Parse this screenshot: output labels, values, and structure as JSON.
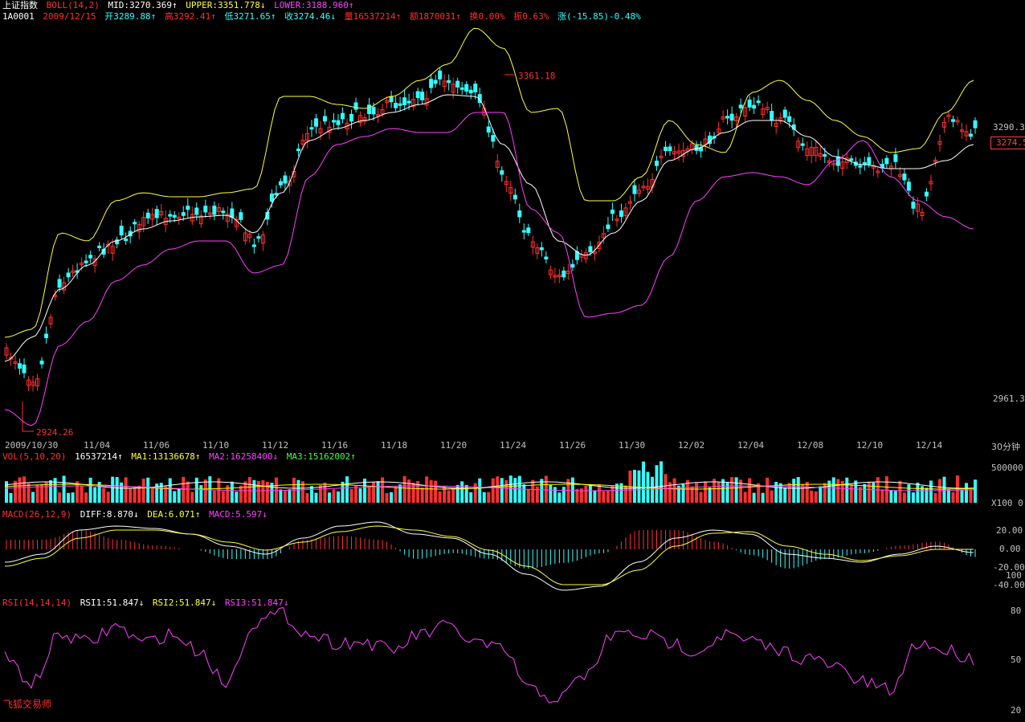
{
  "header1": {
    "index_name": "上证指数",
    "boll_label": "BOLL(14,2)",
    "mid": "MID:3270.369↑",
    "upper": "UPPER:3351.778↓",
    "lower": "LOWER:3188.960↑"
  },
  "header2": {
    "code": "1A0001",
    "date": "2009/12/15",
    "open": "开3289.88↑",
    "high": "高3292.41↑",
    "low": "低3271.65↑",
    "close": "收3274.46↓",
    "volume": "量16537214↑",
    "amount": "额1870031↑",
    "turnover": "换0.00%",
    "amplitude": "振0.63%",
    "change": "涨(-15.85)-0.48%"
  },
  "price_axis": {
    "top": "3290.3",
    "current": "3274.5",
    "bottom": "2961.3"
  },
  "annotations": {
    "high_mark": "3361.18",
    "low_mark": "2924.26"
  },
  "dates": [
    "2009/10/30",
    "11/04",
    "11/06",
    "11/10",
    "11/12",
    "11/16",
    "11/18",
    "11/20",
    "11/24",
    "11/26",
    "11/30",
    "12/02",
    "12/04",
    "12/08",
    "12/10",
    "12/14"
  ],
  "period": "30分钟",
  "vol_header": {
    "label": "VOL(5,10,20)",
    "vol": "16537214↑",
    "ma1": "MA1:13136678↑",
    "ma2": "MA2:16258400↓",
    "ma3": "MA3:15162002↑"
  },
  "vol_axis": {
    "top": "500000",
    "bottom": "X100 0"
  },
  "macd_header": {
    "label": "MACD(26,12,9)",
    "diff": "DIFF:8.870↓",
    "dea": "DEA:6.071↑",
    "macd": "MACD:5.597↓"
  },
  "macd_axis": [
    "20.00",
    "0.00",
    "-20.00",
    "100",
    "-40.00"
  ],
  "rsi_header": {
    "label": "RSI(14,14,14)",
    "rsi1": "RSI1:51.847↓",
    "rsi2": "RSI2:51.847↓",
    "rsi3": "RSI3:51.847↓"
  },
  "rsi_axis": [
    "80",
    "50",
    "20"
  ],
  "brand": "飞狐交易师",
  "colors": {
    "up": "#ff3030",
    "down": "#33ffff",
    "mid": "#ffffff",
    "upper": "#ffff40",
    "lower": "#ff40ff",
    "vol_ma1": "#ffffff",
    "vol_ma2": "#ffff00",
    "vol_ma3": "#ff40ff"
  }
}
